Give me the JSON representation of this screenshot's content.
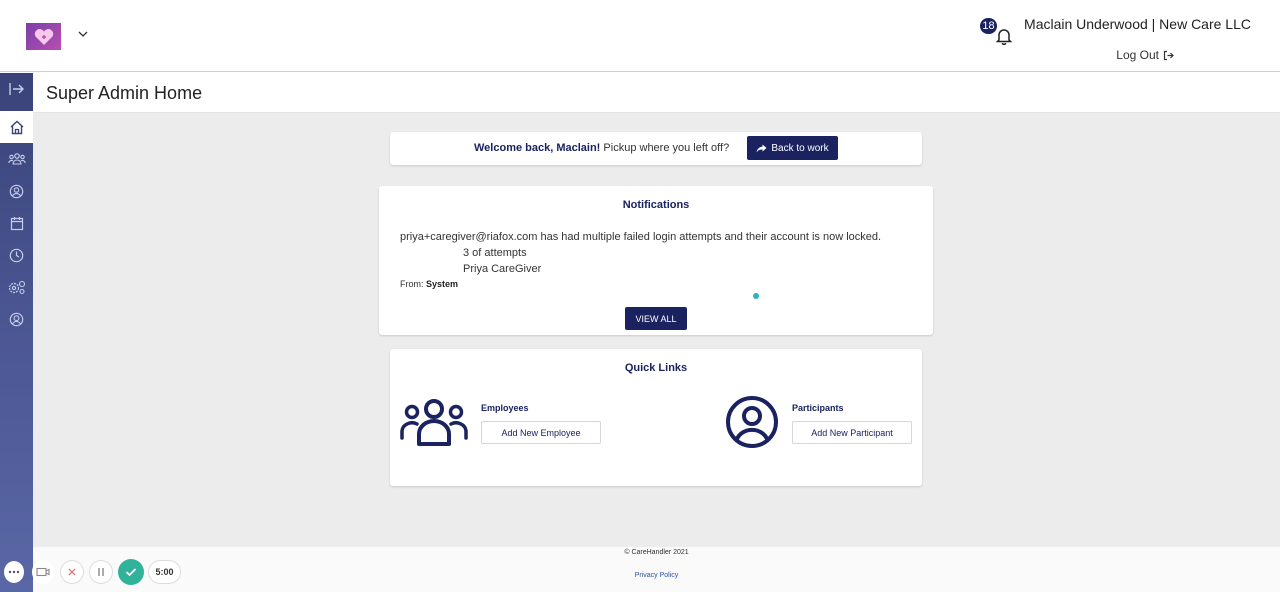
{
  "header": {
    "notification_count": "18",
    "user_label": "Maclain Underwood | New Care LLC",
    "logout_label": "Log Out"
  },
  "sidebar": {
    "items": [
      {
        "icon": "expand-icon"
      },
      {
        "icon": "home-icon",
        "active": true
      },
      {
        "icon": "employees-icon"
      },
      {
        "icon": "participant-icon"
      },
      {
        "icon": "calendar-icon"
      },
      {
        "icon": "clock-icon"
      },
      {
        "icon": "settings-icon"
      },
      {
        "icon": "account-icon"
      }
    ]
  },
  "page": {
    "title": "Super Admin Home"
  },
  "welcome": {
    "greeting": "Welcome back, Maclain!",
    "subtext": "Pickup where you left off?",
    "button_label": "Back to work"
  },
  "notifications": {
    "title": "Notifications",
    "message": "priya+caregiver@riafox.com has had multiple failed login attempts and their account is now locked.",
    "attempts": "3 of attempts",
    "name": "Priya CareGiver",
    "from_label": "From:",
    "from_value": "System",
    "view_all_label": "VIEW ALL"
  },
  "quick_links": {
    "title": "Quick Links",
    "employees_label": "Employees",
    "add_employee_label": "Add New Employee",
    "participants_label": "Participants",
    "add_participant_label": "Add New Participant"
  },
  "footer": {
    "copyright": "© CareHandler 2021",
    "privacy_label": "Privacy Policy"
  },
  "recorder": {
    "timer": "5:00"
  },
  "colors": {
    "brand_navy": "#1a2360",
    "sidebar_top": "#3a4379",
    "recorder_done": "#31b29a"
  }
}
